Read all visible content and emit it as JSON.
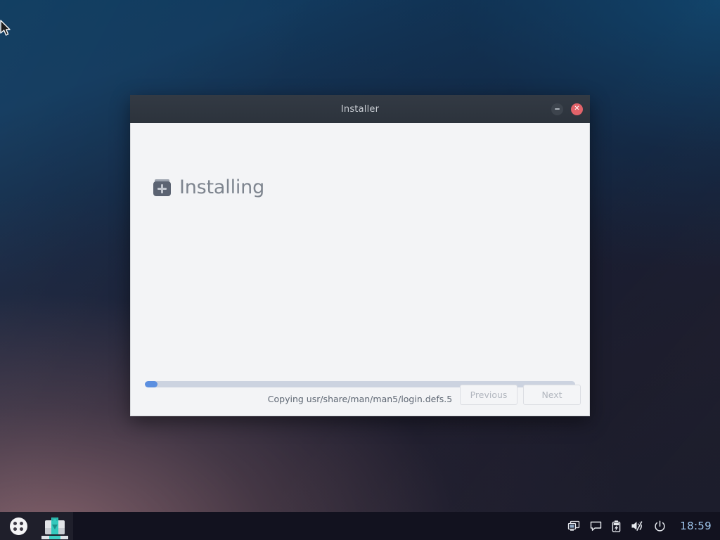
{
  "desktop": {
    "wallpaper_colors": {
      "top_left_navy": "#0c3a5e",
      "bottom_right_dark": "#171827",
      "bottom_left_mauve": "#6b5560"
    },
    "cursor_icon": "arrow-pointer-icon"
  },
  "window": {
    "title": "Installer",
    "titlebar_color": "#2e353e",
    "body_color": "#f3f4f6",
    "controls": {
      "minimize_label": "",
      "minimize_icon": "minimize-icon",
      "close_label": "✕",
      "close_icon": "close-icon",
      "close_color": "#e2636a"
    },
    "page": {
      "heading": "Installing",
      "heading_icon": "package-install-icon",
      "heading_color": "#7e858f"
    },
    "progress": {
      "percent": 3,
      "fill_color": "#5b8fe0",
      "track_color": "#ccd3e0",
      "status_text": "Copying usr/share/man/man5/login.defs.5"
    },
    "buttons": [
      {
        "label": "Previous",
        "name": "previous-button",
        "disabled": true
      },
      {
        "label": "Next",
        "name": "next-button",
        "disabled": true
      }
    ]
  },
  "taskbar": {
    "background": "#12121f",
    "app_menu": {
      "icon": "apps-grid-icon",
      "label": ""
    },
    "items": [
      {
        "label": "",
        "icon": "installer-briefcase-icon",
        "active": true
      }
    ],
    "tray": [
      {
        "icon": "display-monitor-icon",
        "label": ""
      },
      {
        "icon": "chat-bubble-icon",
        "label": ""
      },
      {
        "icon": "battery-charging-icon",
        "label": ""
      },
      {
        "icon": "volume-muted-icon",
        "label": ""
      },
      {
        "icon": "power-icon",
        "label": ""
      }
    ],
    "clock": "18:59",
    "clock_color": "#9fc6ec"
  }
}
